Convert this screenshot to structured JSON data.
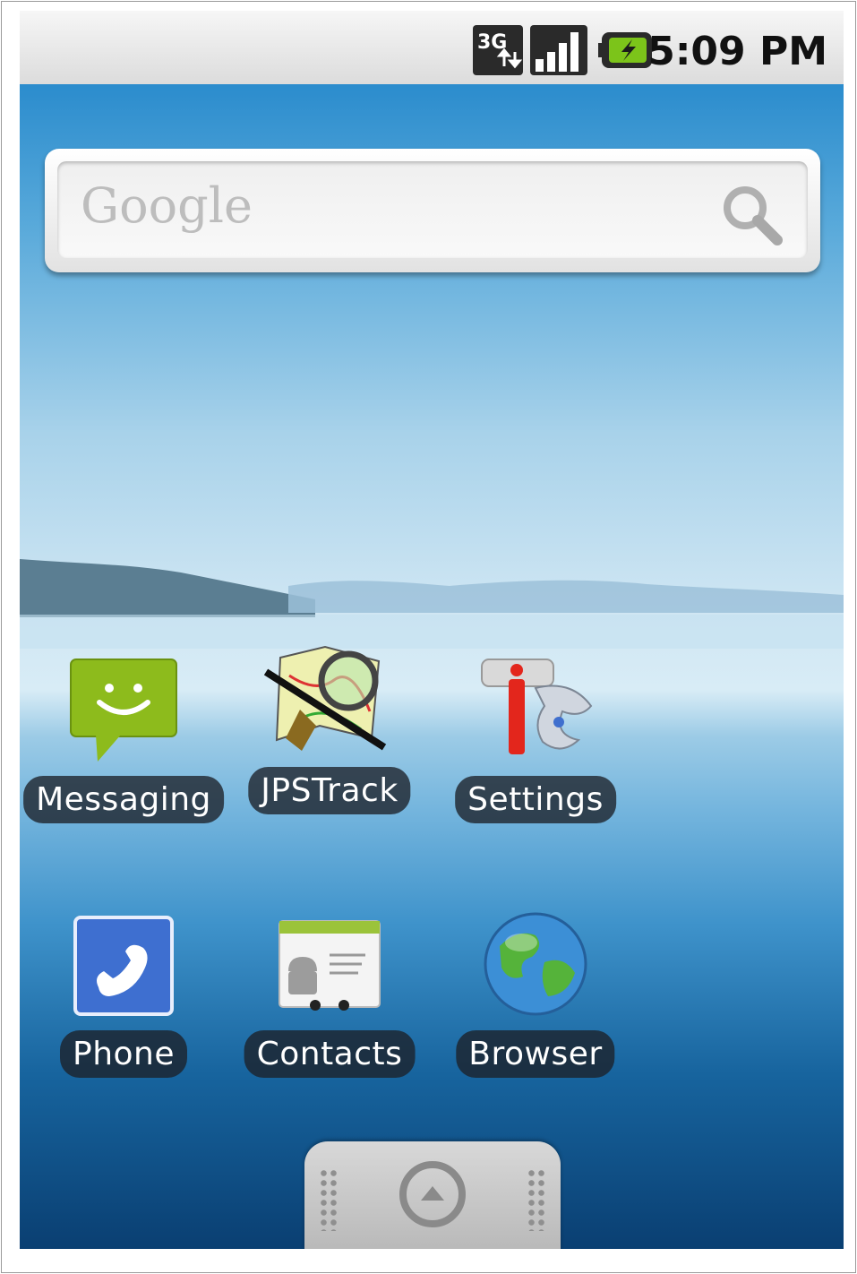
{
  "status_bar": {
    "time": "5:09 PM",
    "icons": [
      "3g-data-icon",
      "signal-strength-icon",
      "battery-charging-icon"
    ],
    "network_label": "3G"
  },
  "search_widget": {
    "logo_text": "Google",
    "search_icon": "search-icon"
  },
  "apps": [
    {
      "label": "Messaging",
      "icon": "messaging-icon"
    },
    {
      "label": "JPSTrack",
      "icon": "jpstrack-icon"
    },
    {
      "label": "Settings",
      "icon": "settings-icon"
    },
    {
      "label": "Phone",
      "icon": "phone-icon"
    },
    {
      "label": "Contacts",
      "icon": "contacts-icon"
    },
    {
      "label": "Browser",
      "icon": "browser-icon"
    }
  ],
  "drawer": {
    "icon": "app-drawer-icon"
  },
  "colors": {
    "status_bar": "#e6e6e6",
    "label_background": "#1c2028",
    "label_text": "#ffffff",
    "messaging_green": "#8dbb1c",
    "phone_blue": "#3e6fd0"
  }
}
